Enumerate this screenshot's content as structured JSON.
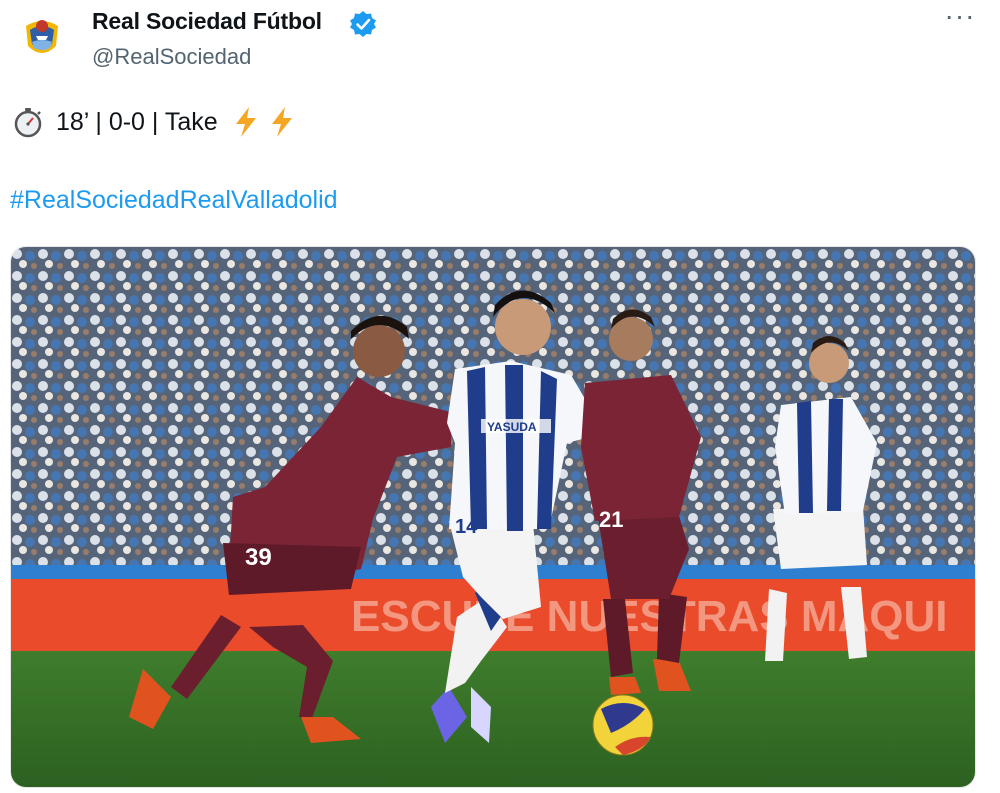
{
  "account": {
    "display_name": "Real Sociedad Fútbol",
    "handle": "@RealSociedad",
    "avatar_icon": "real-sociedad-crest-icon",
    "verified_icon": "verified-badge-icon",
    "verified_color": "#1d9bf0"
  },
  "menu": {
    "more_icon": "more-dots-icon",
    "more_label": "···"
  },
  "tweet": {
    "line1_icon": "stopwatch-icon",
    "line1_text": "18’ | 0-0 | Take",
    "line1_trailing_icons": [
      "lightning-icon",
      "lightning-icon"
    ],
    "hashtag": "#RealSociedadRealValladolid",
    "hashtag_color": "#1d9bf0"
  },
  "media": {
    "type": "photo",
    "player_numbers": [
      "39",
      "14",
      "21"
    ],
    "sponsor": "YASUDA",
    "banner_text": "ESCUDE NUESTRAS MÁQUI"
  }
}
